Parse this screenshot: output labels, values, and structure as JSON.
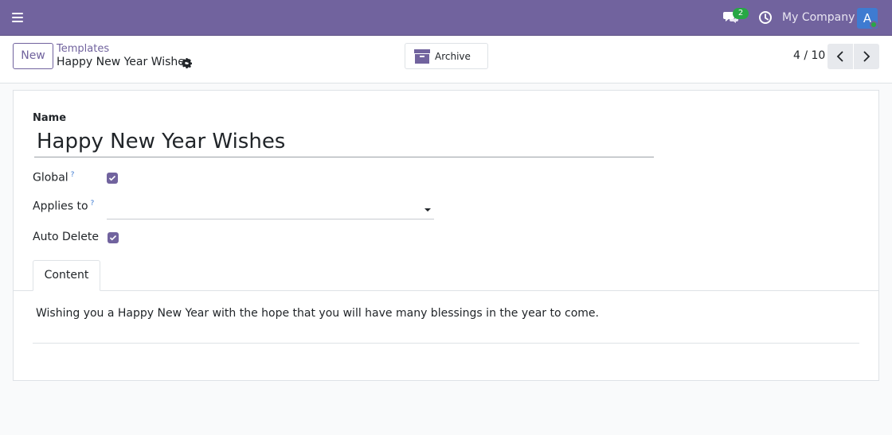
{
  "navbar": {
    "menu_icon": "hamburger-menu-icon",
    "chat_icon": "chat-bubbles-icon",
    "chat_badge": "2",
    "activity_icon": "clock-icon",
    "company": "My Company",
    "avatar_letter": "A",
    "colors": {
      "navbar_bg": "#71639e",
      "badge": "#28a745",
      "avatar": "#3e7bd1"
    }
  },
  "control_panel": {
    "new_label": "New",
    "breadcrumb_parent": "Templates",
    "breadcrumb_current": "Happy New Year Wishes",
    "gear_icon": "gear-icon",
    "archive_label": "Archive",
    "archive_icon": "archive-box-icon",
    "pager_value": "4 / 10",
    "prev_icon": "chevron-left-icon",
    "next_icon": "chevron-right-icon"
  },
  "form": {
    "name_label": "Name",
    "name_value": "Happy New Year Wishes",
    "global_label": "Global",
    "global_help": "?",
    "global_checked": true,
    "applies_label": "Applies to",
    "applies_help": "?",
    "applies_value": "",
    "auto_delete_label": "Auto Delete",
    "auto_delete_checked": true,
    "tabs": [
      {
        "label": "Content",
        "active": true
      }
    ],
    "content_text": "Wishing you a Happy New Year with the hope that you will have many blessings in the year to come."
  }
}
